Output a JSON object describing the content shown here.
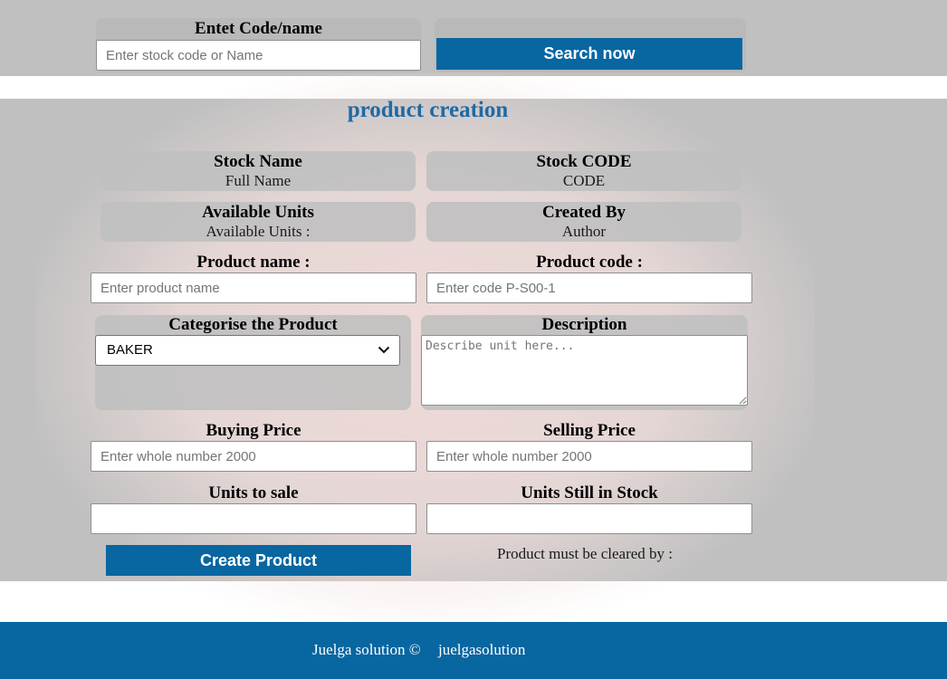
{
  "search": {
    "label": "Entet Code/name",
    "placeholder": "Enter stock code or Name",
    "button": "Search now"
  },
  "section_title": "product creation",
  "info": {
    "stock_name_label": "Stock Name",
    "stock_name_value": "Full Name",
    "stock_code_label": "Stock CODE",
    "stock_code_value": "CODE",
    "available_units_label": "Available Units",
    "available_units_value": "Available Units :",
    "created_by_label": "Created By",
    "created_by_value": "Author"
  },
  "form": {
    "product_name_label": "Product name :",
    "product_name_placeholder": "Enter product name",
    "product_code_label": "Product code :",
    "product_code_placeholder": "Enter code P-S00-1",
    "category_label": "Categorise the Product",
    "category_selected": "BAKER",
    "description_label": "Description",
    "description_placeholder": "Describe unit here...",
    "buying_price_label": "Buying Price",
    "buying_price_placeholder": "Enter whole number 2000",
    "selling_price_label": "Selling Price",
    "selling_price_placeholder": "Enter whole number 2000",
    "units_to_sale_label": "Units to sale",
    "units_to_sale_value": "",
    "units_in_stock_label": "Units Still in Stock",
    "units_in_stock_value": "",
    "create_button": "Create Product",
    "cleared_by_text": "Product must be cleared by :"
  },
  "footer": {
    "copyright": "Juelga solution ©",
    "link": "juelgasolution"
  },
  "colors": {
    "brand_blue": "#0866a1",
    "band_gray": "#c0c0c0",
    "title_blue": "#1f6aa5"
  },
  "icons": {
    "select_arrow": "chevron-down-icon",
    "textarea_resize": "resize-grip-icon"
  }
}
